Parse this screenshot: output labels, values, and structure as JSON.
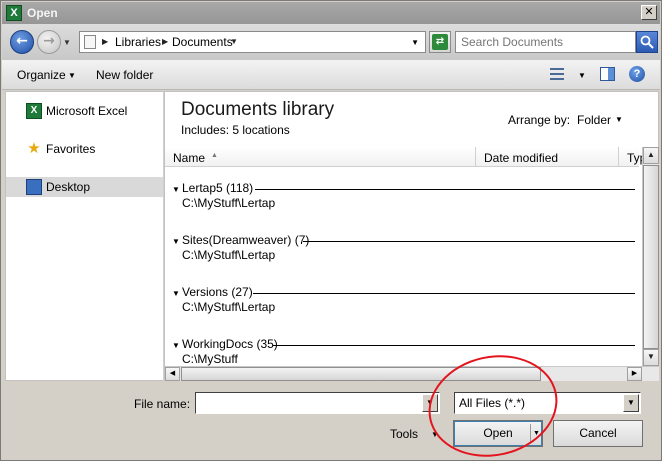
{
  "window": {
    "title": "Open",
    "app_icon_letter": "X"
  },
  "address": {
    "crumbs": [
      "Libraries",
      "Documents"
    ],
    "search_placeholder": "Search Documents"
  },
  "toolbar": {
    "organize": "Organize",
    "new_folder": "New folder",
    "help": "?"
  },
  "nav": [
    {
      "label": "Microsoft Excel",
      "icon": "excel-icon"
    },
    {
      "label": "Favorites",
      "icon": "star-icon"
    },
    {
      "label": "Desktop",
      "icon": "desktop-icon",
      "selected": true
    }
  ],
  "library": {
    "title": "Documents library",
    "includes_label": "Includes:",
    "includes_link": "5 locations",
    "arrange_label": "Arrange by:",
    "arrange_value": "Folder"
  },
  "columns": {
    "name": "Name",
    "date_modified": "Date modified",
    "type": "Typ"
  },
  "groups": [
    {
      "name": "Lertap5 (118)",
      "path": "C:\\MyStuff\\Lertap"
    },
    {
      "name": "Sites(Dreamweaver) (7)",
      "path": "C:\\MyStuff\\Lertap"
    },
    {
      "name": "Versions (27)",
      "path": "C:\\MyStuff\\Lertap"
    },
    {
      "name": "WorkingDocs (35)",
      "path": "C:\\MyStuff"
    }
  ],
  "bottom": {
    "file_name_label": "File name:",
    "file_name_value": "",
    "file_type": "All Files (*.*)",
    "tools": "Tools",
    "open": "Open",
    "cancel": "Cancel"
  },
  "colors": {
    "annotation": "#e4141e",
    "selection": "#d9d9d9",
    "accent": "#2b5bb4"
  }
}
